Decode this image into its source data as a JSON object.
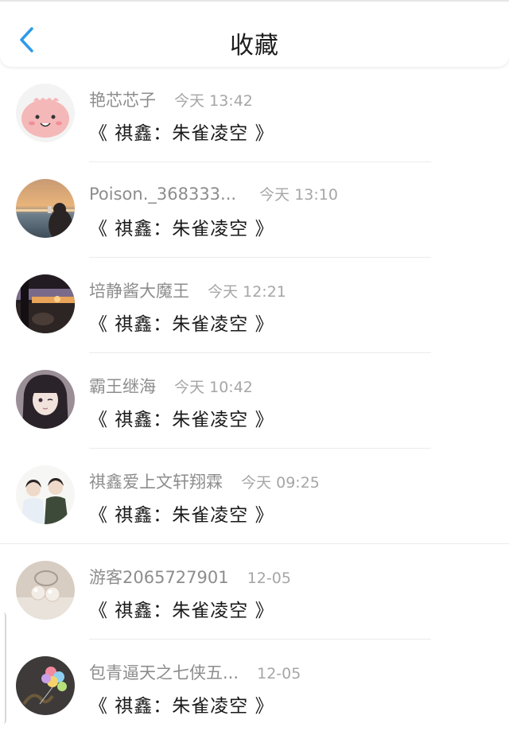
{
  "header": {
    "title": "收藏",
    "back_icon": "chevron-left-icon",
    "accent_color": "#2d9bea"
  },
  "items": [
    {
      "name": "艳芯芯子",
      "time": "今天 13:42",
      "post": "《 祺鑫：朱雀凌空 》"
    },
    {
      "name": "Poison._368333...",
      "time": "今天 13:10",
      "post": "《 祺鑫：朱雀凌空 》"
    },
    {
      "name": "培静酱大魔王",
      "time": "今天 12:21",
      "post": "《 祺鑫：朱雀凌空 》"
    },
    {
      "name": "霸王继海",
      "time": "今天 10:42",
      "post": "《 祺鑫：朱雀凌空 》"
    },
    {
      "name": "祺鑫爱上文轩翔霖",
      "time": "今天 09:25",
      "post": "《 祺鑫：朱雀凌空 》"
    },
    {
      "name": "游客2065727901",
      "time": "12-05",
      "post": "《 祺鑫：朱雀凌空 》"
    },
    {
      "name": "包青逼天之七侠五...",
      "time": "12-05",
      "post": "《 祺鑫：朱雀凌空 》"
    }
  ]
}
